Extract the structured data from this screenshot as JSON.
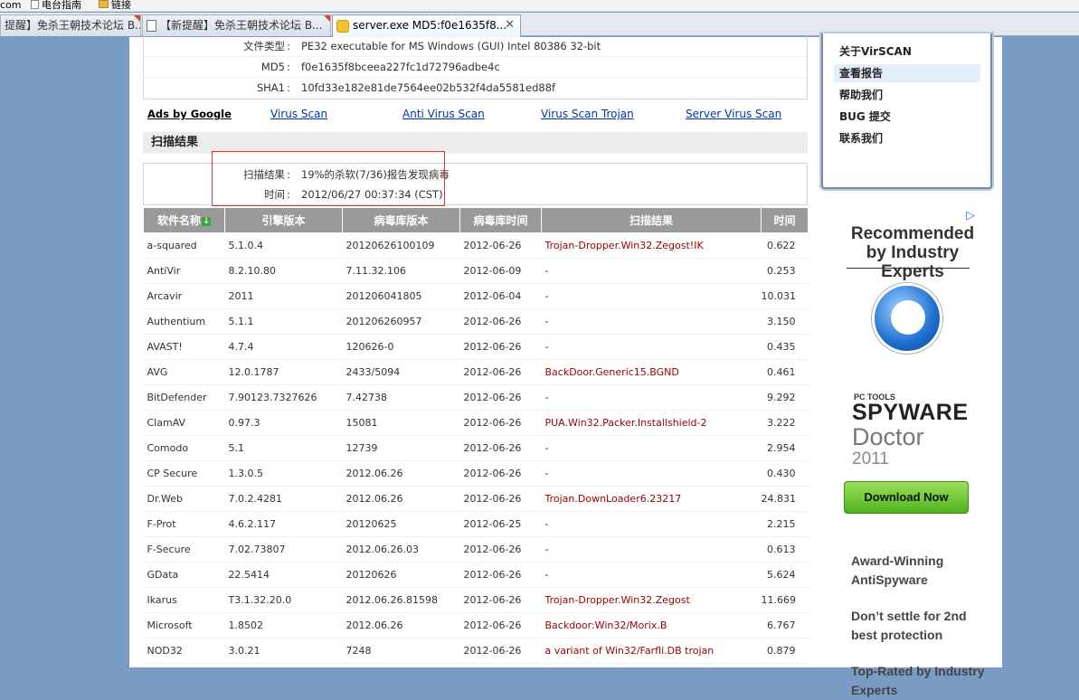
{
  "favorites_bar": {
    "left_text": "com",
    "item1": "电台指南",
    "item2": "链接"
  },
  "tabs": [
    {
      "label": "提醒】免杀王朝技术论坛 B...",
      "active": false
    },
    {
      "label": "【新提醒】免杀王朝技术论坛 B...",
      "active": false
    },
    {
      "label": "server.exe MD5:f0e1635f8...",
      "active": true
    }
  ],
  "file_info": {
    "type_label": "文件类型",
    "type_value": "PE32 executable for MS Windows (GUI) Intel 80386 32-bit",
    "md5_label": "MD5",
    "md5_value": "f0e1635f8bceea227fc1d72796adbe4c",
    "sha1_label": "SHA1",
    "sha1_value": "10fd33e182e81de7564ee02b532f4da5581ed88f"
  },
  "ads_bar": {
    "ads_by": "Ads by Google",
    "links": [
      "Virus Scan",
      "Anti Virus Scan",
      "Virus Scan Trojan",
      "Server Virus Scan"
    ]
  },
  "section_title": "扫描结果",
  "summary": {
    "result_label": "扫描结果",
    "result_value": "19%的杀软(7/36)报告发现病毒",
    "time_label": "时间",
    "time_value": "2012/06/27 00:37:34 (CST)"
  },
  "table": {
    "headers": [
      "软件名称",
      "引擎版本",
      "病毒库版本",
      "病毒库时间",
      "扫描结果",
      "时间"
    ],
    "rows": [
      [
        "a-squared",
        "5.1.0.4",
        "20120626100109",
        "2012-06-26",
        "Trojan-Dropper.Win32.Zegost!IK",
        "0.622"
      ],
      [
        "AntiVir",
        "8.2.10.80",
        "7.11.32.106",
        "2012-06-09",
        "-",
        "0.253"
      ],
      [
        "Arcavir",
        "2011",
        "201206041805",
        "2012-06-04",
        "-",
        "10.031"
      ],
      [
        "Authentium",
        "5.1.1",
        "201206260957",
        "2012-06-26",
        "-",
        "3.150"
      ],
      [
        "AVAST!",
        "4.7.4",
        "120626-0",
        "2012-06-26",
        "-",
        "0.435"
      ],
      [
        "AVG",
        "12.0.1787",
        "2433/5094",
        "2012-06-26",
        "BackDoor.Generic15.BGND",
        "0.461"
      ],
      [
        "BitDefender",
        "7.90123.7327626",
        "7.42738",
        "2012-06-26",
        "-",
        "9.292"
      ],
      [
        "ClamAV",
        "0.97.3",
        "15081",
        "2012-06-26",
        "PUA.Win32.Packer.Installshield-2",
        "3.222"
      ],
      [
        "Comodo",
        "5.1",
        "12739",
        "2012-06-26",
        "-",
        "2.954"
      ],
      [
        "CP Secure",
        "1.3.0.5",
        "2012.06.26",
        "2012-06-26",
        "-",
        "0.430"
      ],
      [
        "Dr.Web",
        "7.0.2.4281",
        "2012.06.26",
        "2012-06-26",
        "Trojan.DownLoader6.23217",
        "24.831"
      ],
      [
        "F-Prot",
        "4.6.2.117",
        "20120625",
        "2012-06-25",
        "-",
        "2.215"
      ],
      [
        "F-Secure",
        "7.02.73807",
        "2012.06.26.03",
        "2012-06-26",
        "-",
        "0.613"
      ],
      [
        "GData",
        "22.5414",
        "20120626",
        "2012-06-26",
        "-",
        "5.624"
      ],
      [
        "Ikarus",
        "T3.1.32.20.0",
        "2012.06.26.81598",
        "2012-06-26",
        "Trojan-Dropper.Win32.Zegost",
        "11.669"
      ],
      [
        "Microsoft",
        "1.8502",
        "2012.06.26",
        "2012-06-26",
        "Backdoor:Win32/Morix.B",
        "6.767"
      ],
      [
        "NOD32",
        "3.0.21",
        "7248",
        "2012-06-26",
        "a variant of Win32/Farfli.DB trojan",
        "0.879"
      ]
    ]
  },
  "menu": {
    "items": [
      "关于VirSCAN",
      "查看报告",
      "帮助我们",
      "BUG 提交",
      "联系我们"
    ],
    "selected_index": 1
  },
  "ad": {
    "headline": "Recommended by Industry Experts",
    "brand_small": "PC TOOLS",
    "brand_big": "SPYWARE",
    "brand_doctor": "Doctor",
    "brand_year": "2011",
    "download": "Download Now",
    "feature1": "Award-Winning AntiSpyware",
    "feature2": "Don’t settle for 2nd best protection",
    "feature3": "Top-Rated by Industry Experts"
  },
  "colors": {
    "background": "#7a9cc4",
    "virus_text": "#990000",
    "header_bg": "#9a9a9a",
    "highlight_border": "#d63838",
    "link": "#0033aa"
  }
}
